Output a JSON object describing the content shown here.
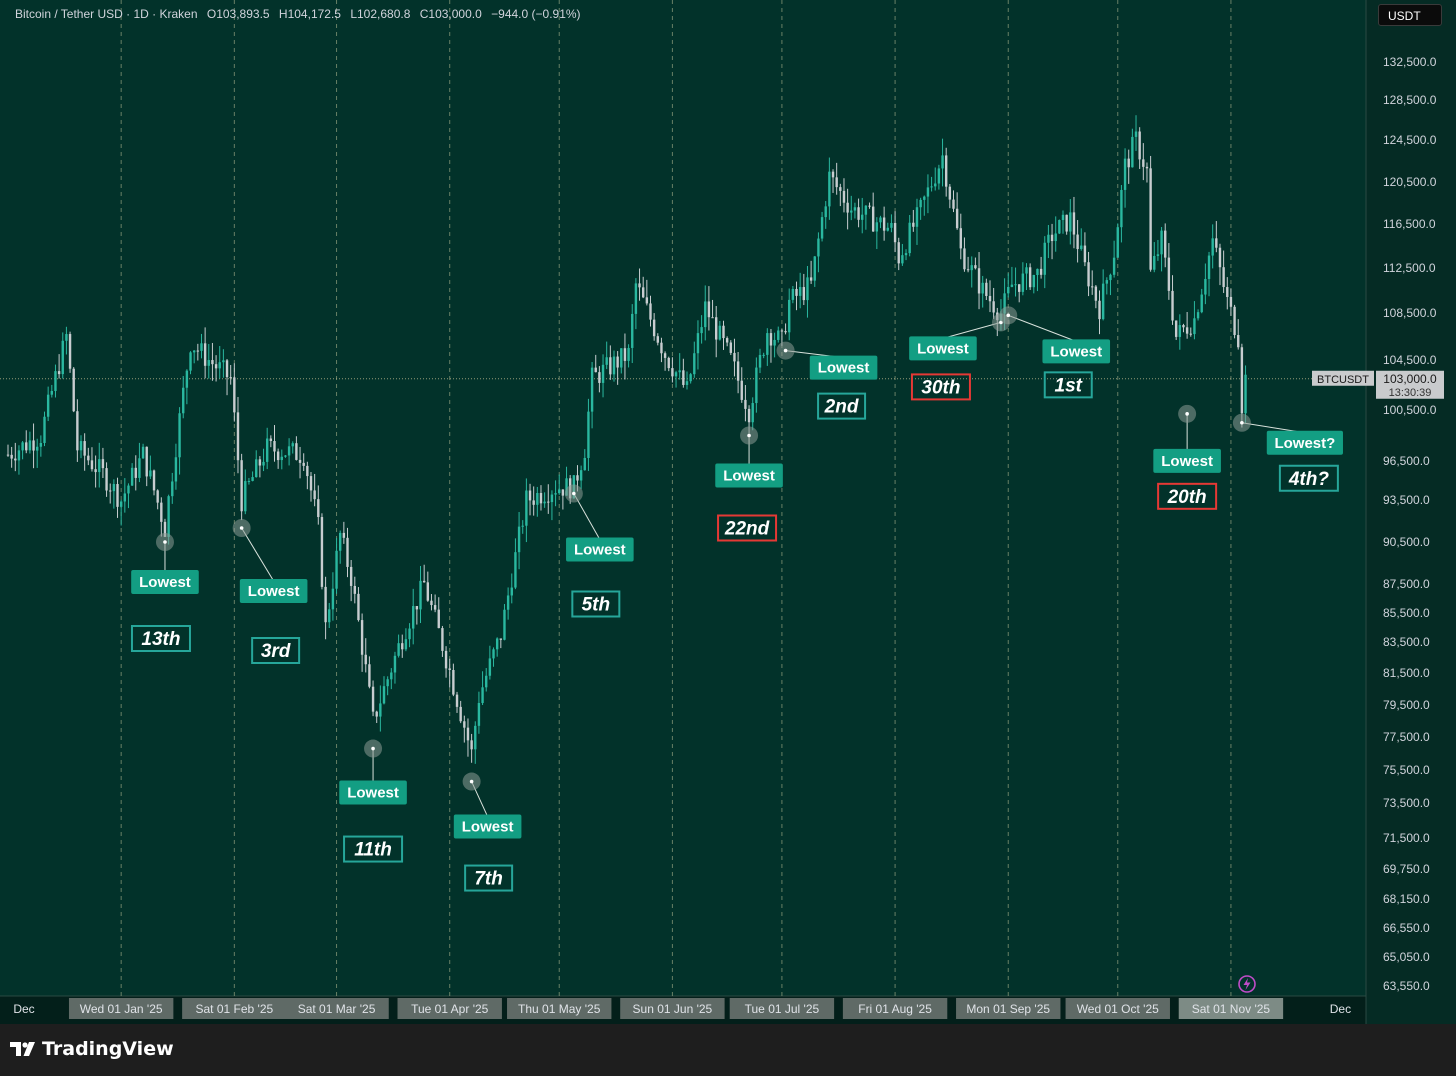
{
  "legend": {
    "symbol": "Bitcoin / Tether USD · 1D · Kraken",
    "open": "O103,893.5",
    "high": "H104,172.5",
    "low": "L102,680.8",
    "close": "C103,000.0",
    "change": "−944.0 (−0.91%)"
  },
  "currency_button": "USDT",
  "brand": {
    "name": "TradingView"
  },
  "colors": {
    "background": "#02322a",
    "candle": "#c8cdd0",
    "label_fill": "#139e83",
    "label_text": "#ffffff",
    "rank_border_green": "#26a69a",
    "rank_border_red": "#e53935",
    "grid_dash": "#8a9a7a",
    "axis_text": "#d1d4dc"
  },
  "chart_data": {
    "type": "candlestick",
    "symbol": "BTCUSDT",
    "interval": "1D",
    "ylim": [
      63550,
      136000
    ],
    "y_ticks": [
      {
        "value": 132500,
        "label": "132,500.0"
      },
      {
        "value": 128500,
        "label": "128,500.0"
      },
      {
        "value": 124500,
        "label": "124,500.0"
      },
      {
        "value": 120500,
        "label": "120,500.0"
      },
      {
        "value": 116500,
        "label": "116,500.0"
      },
      {
        "value": 112500,
        "label": "112,500.0"
      },
      {
        "value": 108500,
        "label": "108,500.0"
      },
      {
        "value": 104500,
        "label": "104,500.0"
      },
      {
        "value": 100500,
        "label": "100,500.0"
      },
      {
        "value": 96500,
        "label": "96,500.0"
      },
      {
        "value": 93500,
        "label": "93,500.0"
      },
      {
        "value": 90500,
        "label": "90,500.0"
      },
      {
        "value": 87500,
        "label": "87,500.0"
      },
      {
        "value": 85500,
        "label": "85,500.0"
      },
      {
        "value": 83500,
        "label": "83,500.0"
      },
      {
        "value": 81500,
        "label": "81,500.0"
      },
      {
        "value": 79500,
        "label": "79,500.0"
      },
      {
        "value": 77500,
        "label": "77,500.0"
      },
      {
        "value": 75500,
        "label": "75,500.0"
      },
      {
        "value": 73500,
        "label": "73,500.0"
      },
      {
        "value": 71500,
        "label": "71,500.0"
      },
      {
        "value": 69750,
        "label": "69,750.0"
      },
      {
        "value": 68150,
        "label": "68,150.0"
      },
      {
        "value": 66550,
        "label": "66,550.0"
      },
      {
        "value": 65050,
        "label": "65,050.0"
      },
      {
        "value": 63550,
        "label": "63,550.0"
      }
    ],
    "x_ticks": [
      {
        "date": "2024-12-01",
        "label": "Dec",
        "boxed": false
      },
      {
        "date": "2025-01-01",
        "label": "Wed 01 Jan '25",
        "boxed": true
      },
      {
        "date": "2025-02-01",
        "label": "Sat 01 Feb '25",
        "boxed": true
      },
      {
        "date": "2025-03-01",
        "label": "Sat 01 Mar '25",
        "boxed": true
      },
      {
        "date": "2025-04-01",
        "label": "Tue 01 Apr '25",
        "boxed": true
      },
      {
        "date": "2025-05-01",
        "label": "Thu 01 May '25",
        "boxed": true
      },
      {
        "date": "2025-06-01",
        "label": "Sun 01 Jun '25",
        "boxed": true
      },
      {
        "date": "2025-07-01",
        "label": "Tue 01 Jul '25",
        "boxed": true
      },
      {
        "date": "2025-08-01",
        "label": "Fri 01 Aug '25",
        "boxed": true
      },
      {
        "date": "2025-09-01",
        "label": "Mon 01 Sep '25",
        "boxed": true
      },
      {
        "date": "2025-10-01",
        "label": "Wed 01 Oct '25",
        "boxed": true
      },
      {
        "date": "2025-11-01",
        "label": "Sat 01 Nov '25",
        "boxed": true,
        "highlight": true
      },
      {
        "date": "2025-12-01",
        "label": "Dec",
        "boxed": false
      }
    ],
    "month_lines": [
      "2025-01-01",
      "2025-02-01",
      "2025-03-01",
      "2025-04-01",
      "2025-05-01",
      "2025-06-01",
      "2025-07-01",
      "2025-08-01",
      "2025-09-01",
      "2025-10-01",
      "2025-11-01"
    ],
    "x_start": "2024-12-01",
    "x_end": "2025-12-08",
    "last_price": {
      "value": 103000,
      "label": "103,000.0",
      "countdown": "13:30:39",
      "symbol_label": "BTCUSDT"
    },
    "key_points": [
      {
        "date": "2024-12-01",
        "price": 97000
      },
      {
        "date": "2024-12-10",
        "price": 98500
      },
      {
        "date": "2024-12-17",
        "price": 106500
      },
      {
        "date": "2024-12-20",
        "price": 97500
      },
      {
        "date": "2024-12-27",
        "price": 95500
      },
      {
        "date": "2025-01-01",
        "price": 93500
      },
      {
        "date": "2025-01-07",
        "price": 97000
      },
      {
        "date": "2025-01-13",
        "price": 91500
      },
      {
        "date": "2025-01-20",
        "price": 106000
      },
      {
        "date": "2025-01-25",
        "price": 104500
      },
      {
        "date": "2025-01-31",
        "price": 103000
      },
      {
        "date": "2025-02-03",
        "price": 93500
      },
      {
        "date": "2025-02-10",
        "price": 97500
      },
      {
        "date": "2025-02-20",
        "price": 97000
      },
      {
        "date": "2025-02-24",
        "price": 91500
      },
      {
        "date": "2025-02-26",
        "price": 84500
      },
      {
        "date": "2025-03-02",
        "price": 91000
      },
      {
        "date": "2025-03-05",
        "price": 88000
      },
      {
        "date": "2025-03-11",
        "price": 78500
      },
      {
        "date": "2025-03-20",
        "price": 84500
      },
      {
        "date": "2025-03-25",
        "price": 87500
      },
      {
        "date": "2025-03-31",
        "price": 82500
      },
      {
        "date": "2025-04-07",
        "price": 76500
      },
      {
        "date": "2025-04-09",
        "price": 80000
      },
      {
        "date": "2025-04-15",
        "price": 84000
      },
      {
        "date": "2025-04-22",
        "price": 93500
      },
      {
        "date": "2025-04-30",
        "price": 94500
      },
      {
        "date": "2025-05-05",
        "price": 94500
      },
      {
        "date": "2025-05-08",
        "price": 97500
      },
      {
        "date": "2025-05-10",
        "price": 103000
      },
      {
        "date": "2025-05-20",
        "price": 105000
      },
      {
        "date": "2025-05-22",
        "price": 111000
      },
      {
        "date": "2025-05-30",
        "price": 105000
      },
      {
        "date": "2025-06-05",
        "price": 102000
      },
      {
        "date": "2025-06-10",
        "price": 109000
      },
      {
        "date": "2025-06-17",
        "price": 104500
      },
      {
        "date": "2025-06-22",
        "price": 100500
      },
      {
        "date": "2025-06-27",
        "price": 107000
      },
      {
        "date": "2025-07-01",
        "price": 106000
      },
      {
        "date": "2025-07-03",
        "price": 109500
      },
      {
        "date": "2025-07-09",
        "price": 111000
      },
      {
        "date": "2025-07-14",
        "price": 121000
      },
      {
        "date": "2025-07-20",
        "price": 118000
      },
      {
        "date": "2025-07-31",
        "price": 116000
      },
      {
        "date": "2025-08-02",
        "price": 113500
      },
      {
        "date": "2025-08-07",
        "price": 117000
      },
      {
        "date": "2025-08-14",
        "price": 123000
      },
      {
        "date": "2025-08-19",
        "price": 114000
      },
      {
        "date": "2025-08-25",
        "price": 110500
      },
      {
        "date": "2025-08-30",
        "price": 108500
      },
      {
        "date": "2025-09-02",
        "price": 111000
      },
      {
        "date": "2025-09-09",
        "price": 112000
      },
      {
        "date": "2025-09-13",
        "price": 115500
      },
      {
        "date": "2025-09-18",
        "price": 117000
      },
      {
        "date": "2025-09-22",
        "price": 112500
      },
      {
        "date": "2025-09-26",
        "price": 109000
      },
      {
        "date": "2025-09-30",
        "price": 114000
      },
      {
        "date": "2025-10-03",
        "price": 122000
      },
      {
        "date": "2025-10-06",
        "price": 124500
      },
      {
        "date": "2025-10-09",
        "price": 121500
      },
      {
        "date": "2025-10-10",
        "price": 112000
      },
      {
        "date": "2025-10-13",
        "price": 115000
      },
      {
        "date": "2025-10-17",
        "price": 106500
      },
      {
        "date": "2025-10-22",
        "price": 108000
      },
      {
        "date": "2025-10-27",
        "price": 115000
      },
      {
        "date": "2025-10-31",
        "price": 109500
      },
      {
        "date": "2025-11-03",
        "price": 106500
      },
      {
        "date": "2025-11-04",
        "price": 101000
      },
      {
        "date": "2025-11-05",
        "price": 103000
      }
    ],
    "annotations": [
      {
        "date": "2025-01-13",
        "price": 90500,
        "label": "Lowest",
        "rank": "13th",
        "rank_color": "green",
        "label_dx": 0,
        "label_dy": 40,
        "rank_dx": -4,
        "rank_dy": 96
      },
      {
        "date": "2025-02-03",
        "price": 91500,
        "label": "Lowest",
        "rank": "3rd",
        "rank_color": "green",
        "label_dx": 32,
        "label_dy": 63,
        "rank_dx": 34,
        "rank_dy": 122
      },
      {
        "date": "2025-03-11",
        "price": 76800,
        "label": "Lowest",
        "rank": "11th",
        "rank_color": "green",
        "label_dx": 0,
        "label_dy": 44,
        "rank_dx": 0,
        "rank_dy": 100
      },
      {
        "date": "2025-04-07",
        "price": 74800,
        "label": "Lowest",
        "rank": "7th",
        "rank_color": "green",
        "label_dx": 16,
        "label_dy": 45,
        "rank_dx": 17,
        "rank_dy": 96
      },
      {
        "date": "2025-05-05",
        "price": 94000,
        "label": "Lowest",
        "rank": "5th",
        "rank_color": "green",
        "label_dx": 26,
        "label_dy": 56,
        "rank_dx": 22,
        "rank_dy": 110
      },
      {
        "date": "2025-06-22",
        "price": 98500,
        "label": "Lowest",
        "rank": "22nd",
        "rank_color": "red",
        "label_dx": 0,
        "label_dy": 40,
        "rank_dx": -2,
        "rank_dy": 92
      },
      {
        "date": "2025-07-02",
        "price": 105300,
        "label": "Lowest",
        "rank": "2nd",
        "rank_color": "green",
        "label_dx": 58,
        "label_dy": 17,
        "rank_dx": 56,
        "rank_dy": 55
      },
      {
        "date": "2025-08-30",
        "price": 107700,
        "label": "Lowest",
        "rank": "30th",
        "rank_color": "red",
        "label_dx": -58,
        "label_dy": 26,
        "rank_dx": -60,
        "rank_dy": 64
      },
      {
        "date": "2025-09-01",
        "price": 108300,
        "label": "Lowest",
        "rank": "1st",
        "rank_color": "green",
        "label_dx": 68,
        "label_dy": 36,
        "rank_dx": 60,
        "rank_dy": 69
      },
      {
        "date": "2025-10-20",
        "price": 100200,
        "label": "Lowest",
        "rank": "20th",
        "rank_color": "red",
        "label_dx": 0,
        "label_dy": 47,
        "rank_dx": 0,
        "rank_dy": 82
      },
      {
        "date": "2025-11-04",
        "price": 99500,
        "label": "Lowest?",
        "rank": "4th?",
        "rank_color": "green",
        "label_dx": 63,
        "label_dy": 20,
        "rank_dx": 67,
        "rank_dy": 55
      }
    ]
  }
}
